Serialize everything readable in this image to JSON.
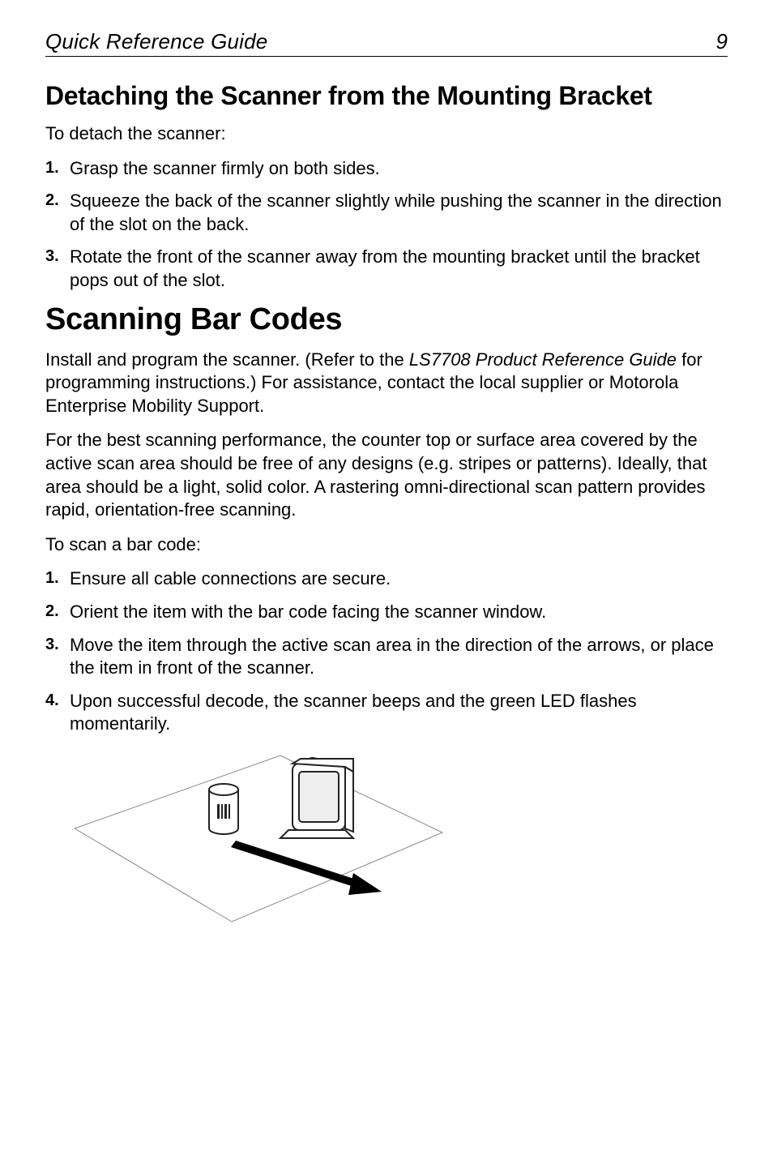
{
  "header": {
    "title": "Quick Reference Guide",
    "page": "9"
  },
  "section1": {
    "heading": "Detaching the Scanner from the Mounting Bracket",
    "intro": "To detach the scanner:",
    "steps": [
      "Grasp the scanner firmly on both sides.",
      "Squeeze the back of the scanner slightly while pushing the scanner in the direction of the slot on the back.",
      "Rotate the front of the scanner away from the mounting bracket until the bracket pops out of the slot."
    ]
  },
  "section2": {
    "heading": "Scanning Bar Codes",
    "para1_pre": "Install and program the scanner. (Refer to the ",
    "para1_italic": "LS7708 Product Reference Guide",
    "para1_post": " for programming instructions.) For assistance, contact the local supplier or Motorola Enterprise Mobility Support.",
    "para2": "For the best scanning performance, the counter top or surface area covered by the active scan area should be free of any designs (e.g. stripes or patterns). Ideally, that area should be a light, solid color. A rastering omni-directional scan pattern provides rapid, orientation-free scanning.",
    "para3": "To scan a bar code:",
    "steps": [
      "Ensure all cable connections are secure.",
      "Orient the item with the bar code facing the scanner window.",
      "Move the item through the active scan area in the direction of the arrows, or place the item in front of the scanner.",
      "Upon successful decode, the scanner beeps and the green LED flashes momentarily."
    ]
  },
  "markers": {
    "m1": "1.",
    "m2": "2.",
    "m3": "3.",
    "m4": "4."
  }
}
